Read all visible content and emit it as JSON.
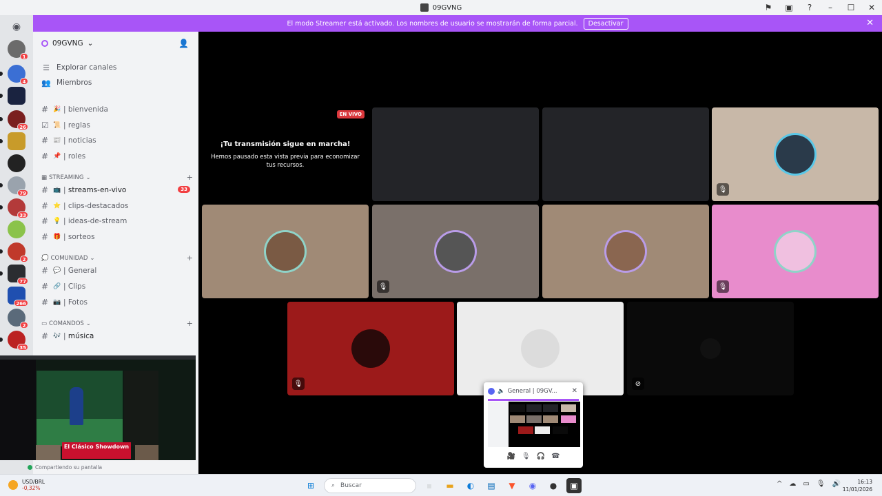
{
  "window": {
    "title": "09GVNG",
    "controls": [
      "flag-icon",
      "display-icon",
      "help-icon",
      "minimize",
      "maximize",
      "close"
    ]
  },
  "banner": {
    "message": "El modo Streamer está activado. Los nombres de usuario se mostrarán de forma parcial.",
    "button": "Desactivar",
    "color": "#a855f7"
  },
  "rail": {
    "badges": [
      "1",
      "4",
      "26",
      "79",
      "33",
      "2",
      "77",
      "266",
      "2",
      "35"
    ]
  },
  "sidebar": {
    "server_name": "09GVNG",
    "nav": [
      {
        "label": "Explorar canales",
        "icon": "explore-icon"
      },
      {
        "label": "Miembros",
        "icon": "members-icon"
      }
    ],
    "top_channels": [
      {
        "name": "bienvenida",
        "emoji": "🎉"
      },
      {
        "name": "reglas",
        "emoji": "📜"
      },
      {
        "name": "noticias",
        "emoji": "📰"
      },
      {
        "name": "roles",
        "emoji": "📌"
      }
    ],
    "categories": [
      {
        "name": "STREAMING",
        "channels": [
          {
            "name": "streams-en-vivo",
            "emoji": "📺",
            "count": "33"
          },
          {
            "name": "clips-destacados",
            "emoji": "⭐"
          },
          {
            "name": "ideas-de-stream",
            "emoji": "💡"
          },
          {
            "name": "sorteos",
            "emoji": "🎁"
          }
        ]
      },
      {
        "name": "COMUNIDAD",
        "channels": [
          {
            "name": "General",
            "emoji": "💬"
          },
          {
            "name": "Clips",
            "emoji": "🔗"
          },
          {
            "name": "Fotos",
            "emoji": "📷"
          }
        ]
      },
      {
        "name": "COMANDOS",
        "channels": [
          {
            "name": "música",
            "emoji": "🎶"
          }
        ]
      }
    ],
    "separator": "|"
  },
  "share": {
    "banner_text": "El Clásico Showdown",
    "status": "Compartiendo su pantalla"
  },
  "stream": {
    "live_badge": "EN VIVO",
    "title": "¡Tu transmisión sigue en marcha!",
    "subtitle": "Hemos pausado esta vista previa para economizar tus recursos."
  },
  "popout": {
    "title": "General | 09GV..."
  },
  "taskbar": {
    "weather_label": "USD/BRL",
    "weather_value": "-0,32%",
    "search_placeholder": "Buscar",
    "time": "16:13",
    "date": "11/01/2026"
  }
}
